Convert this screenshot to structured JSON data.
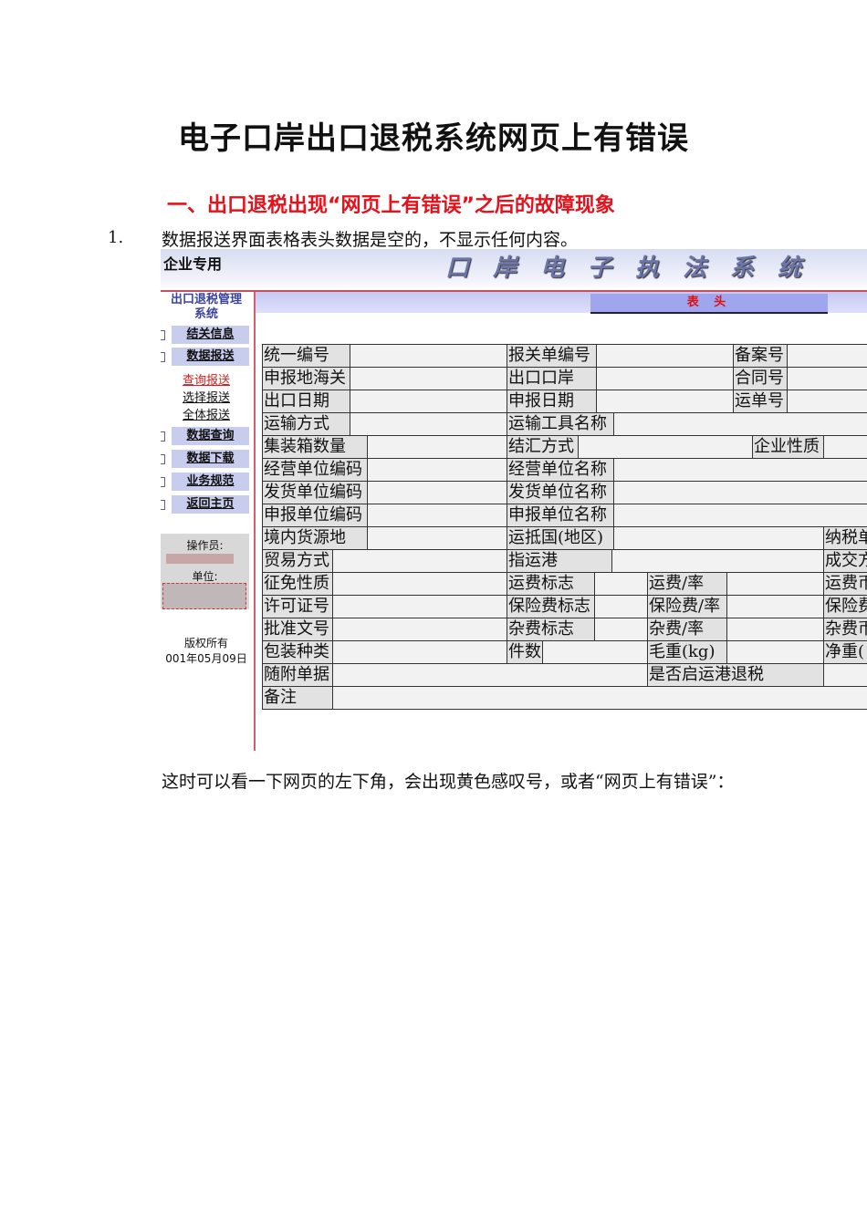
{
  "title": "电子口岸出口退税系统网页上有错误",
  "section": "一、出口退税出现“网页上有错误”之后的故障现象",
  "item1": {
    "num": "1.",
    "text": "数据报送界面表格表头数据是空的，不显示任何内容。"
  },
  "screenshot": {
    "corp": "企业专用",
    "system": "口岸电子执法系统",
    "tab": "表 头",
    "sidebar_title": [
      "出口退税管理",
      "系统"
    ],
    "menu": [
      "结关信息",
      "数据报送",
      "数据查询",
      "数据下载",
      "业务规范",
      "返回主页"
    ],
    "submenu": [
      "查询报送",
      "选择报送",
      "全体报送"
    ],
    "operator_label": "操作员:",
    "unit_label": "单位:",
    "copyright": "版权所有",
    "date": "001年05月09日",
    "fields": [
      "统一编号",
      "报关单编号",
      "备案号",
      "申报地海关",
      "出口口岸",
      "合同号",
      "出口日期",
      "申报日期",
      "运单号",
      "运输方式",
      "运输工具名称",
      "集装箱数量",
      "结汇方式",
      "企业性质",
      "经营单位编码",
      "经营单位名称",
      "发货单位编码",
      "发货单位名称",
      "申报单位编码",
      "申报单位名称",
      "境内货源地",
      "运抵国(地区)",
      "纳税单",
      "贸易方式",
      "指运港",
      "成交方",
      "征免性质",
      "运费标志",
      "运费/率",
      "运费币",
      "许可证号",
      "保险费标志",
      "保险费/率",
      "保险费",
      "批准文号",
      "杂费标志",
      "杂费/率",
      "杂费币",
      "包装种类",
      "件数",
      "毛重(kg)",
      "净重(",
      "随附单据",
      "是否启运港退税",
      "备注"
    ]
  },
  "para": "这时可以看一下网页的左下角，会出现黄色感叹号，或者“网页上有错误”："
}
